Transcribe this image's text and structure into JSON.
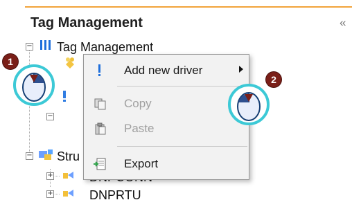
{
  "panel": {
    "title": "Tag Management",
    "collapse_icon": "double-chevron-left"
  },
  "tree": {
    "root": {
      "label": "Tag Management",
      "expanded": true,
      "icon": "tag-management-icon"
    },
    "children": [
      {
        "label": "Stru",
        "icon": "structure-icon",
        "expanded": true
      },
      {
        "label": "DNPCONN",
        "icon": "connection-icon",
        "expanded": false
      },
      {
        "label": "DNPRTU",
        "icon": "rtu-icon",
        "expanded": false
      }
    ]
  },
  "context_menu": {
    "items": [
      {
        "label": "Add new driver",
        "enabled": true,
        "has_submenu": true,
        "icon": "add-driver-icon"
      },
      {
        "label": "Copy",
        "enabled": false,
        "has_submenu": false,
        "icon": "copy-icon"
      },
      {
        "label": "Paste",
        "enabled": false,
        "has_submenu": false,
        "icon": "paste-icon"
      },
      {
        "label": "Export",
        "enabled": true,
        "has_submenu": false,
        "icon": "export-icon"
      }
    ]
  },
  "steps": [
    {
      "number": "1",
      "action": "right-click"
    },
    {
      "number": "2",
      "action": "left-click"
    }
  ],
  "colors": {
    "accent_line": "#f2a33a",
    "step_badge": "#7a1f18",
    "mouse_ring": "#3cc9d6"
  }
}
